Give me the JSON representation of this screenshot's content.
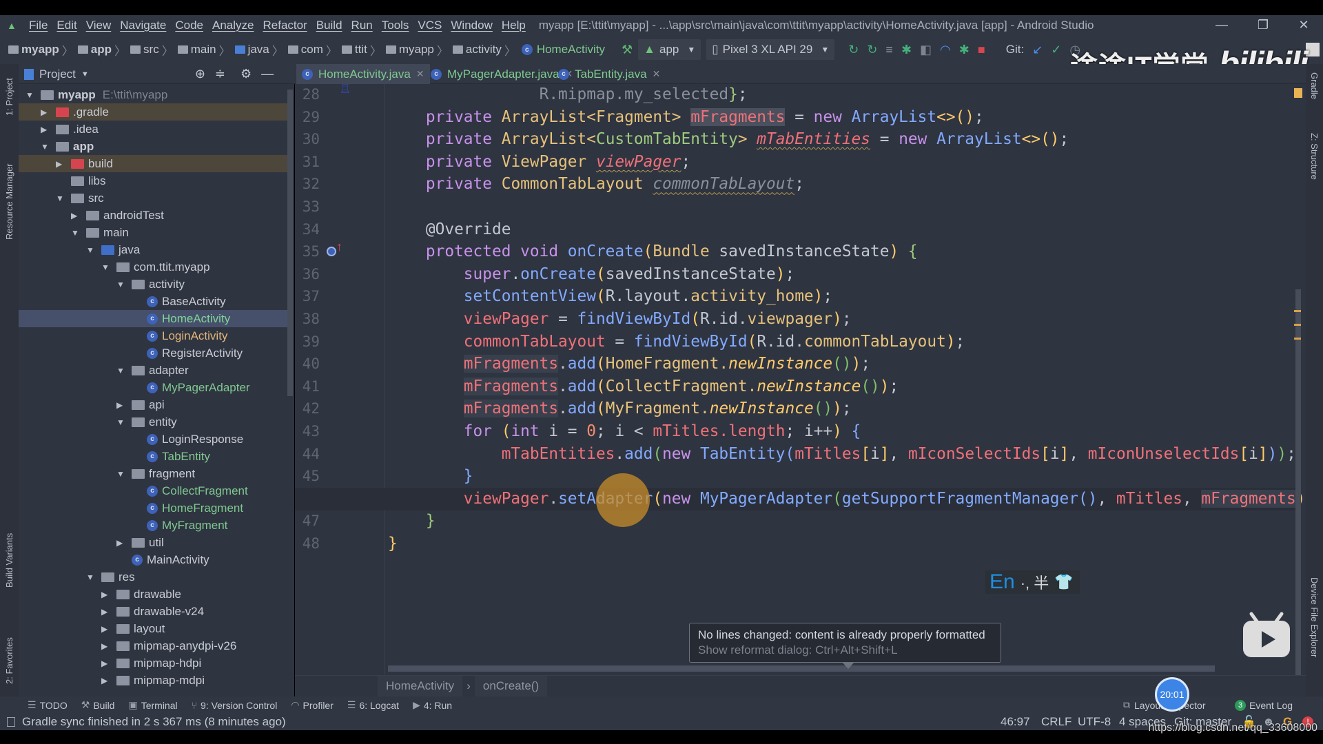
{
  "window": {
    "menu": [
      "File",
      "Edit",
      "View",
      "Navigate",
      "Code",
      "Analyze",
      "Refactor",
      "Build",
      "Run",
      "Tools",
      "VCS",
      "Window",
      "Help"
    ],
    "title": "myapp [E:\\ttit\\myapp] - ...\\app\\src\\main\\java\\com\\ttit\\myapp\\activity\\HomeActivity.java [app] - Android Studio",
    "controls": {
      "minimize": "—",
      "restore": "❐",
      "close": "✕"
    }
  },
  "navbar": {
    "breadcrumbs": [
      "myapp",
      "app",
      "src",
      "main",
      "java",
      "com",
      "ttit",
      "myapp",
      "activity",
      "HomeActivity"
    ],
    "run_config": "app",
    "device": "Pixel 3 XL API 29",
    "git_label": "Git:",
    "icons": [
      "hammer-icon",
      "apply-changes-icon",
      "apply-code-changes-icon",
      "sync-icon",
      "debug-icon",
      "attach-icon",
      "profiler-icon",
      "debug-attach-icon",
      "stop-icon",
      "git-update-icon",
      "git-commit-icon",
      "history-icon",
      "revert-icon",
      "folder-icon",
      "translate-icon",
      "device-manager-icon",
      "user-icon"
    ]
  },
  "project_panel": {
    "title": "Project",
    "tree": [
      {
        "label": "myapp",
        "hint": "E:\\ttit\\myapp",
        "depth": 0,
        "arrow": "down",
        "icon": "module",
        "bold": true
      },
      {
        "label": ".gradle",
        "depth": 1,
        "arrow": "right",
        "icon": "folder-excluded",
        "excluded": true
      },
      {
        "label": ".idea",
        "depth": 1,
        "arrow": "right",
        "icon": "folder"
      },
      {
        "label": "app",
        "depth": 1,
        "arrow": "down",
        "icon": "android-module",
        "bold": true
      },
      {
        "label": "build",
        "depth": 2,
        "arrow": "right",
        "icon": "folder-excluded",
        "excluded": true
      },
      {
        "label": "libs",
        "depth": 2,
        "icon": "folder"
      },
      {
        "label": "src",
        "depth": 2,
        "arrow": "down",
        "icon": "folder"
      },
      {
        "label": "androidTest",
        "depth": 3,
        "arrow": "right",
        "icon": "folder"
      },
      {
        "label": "main",
        "depth": 3,
        "arrow": "down",
        "icon": "folder"
      },
      {
        "label": "java",
        "depth": 4,
        "arrow": "down",
        "icon": "folder-source"
      },
      {
        "label": "com.ttit.myapp",
        "depth": 5,
        "arrow": "down",
        "icon": "package"
      },
      {
        "label": "activity",
        "depth": 6,
        "arrow": "down",
        "icon": "package"
      },
      {
        "label": "BaseActivity",
        "depth": 7,
        "icon": "class"
      },
      {
        "label": "HomeActivity",
        "depth": 7,
        "icon": "class",
        "color": "#7fd69a",
        "selected": true
      },
      {
        "label": "LoginActivity",
        "depth": 7,
        "icon": "class",
        "color": "#e3b77a"
      },
      {
        "label": "RegisterActivity",
        "depth": 7,
        "icon": "class"
      },
      {
        "label": "adapter",
        "depth": 6,
        "arrow": "down",
        "icon": "package"
      },
      {
        "label": "MyPagerAdapter",
        "depth": 7,
        "icon": "class",
        "color": "#7fc98f"
      },
      {
        "label": "api",
        "depth": 6,
        "arrow": "right",
        "icon": "package"
      },
      {
        "label": "entity",
        "depth": 6,
        "arrow": "down",
        "icon": "package"
      },
      {
        "label": "LoginResponse",
        "depth": 7,
        "icon": "class"
      },
      {
        "label": "TabEntity",
        "depth": 7,
        "icon": "class",
        "color": "#7fc98f"
      },
      {
        "label": "fragment",
        "depth": 6,
        "arrow": "down",
        "icon": "package"
      },
      {
        "label": "CollectFragment",
        "depth": 7,
        "icon": "class",
        "color": "#7fc98f"
      },
      {
        "label": "HomeFragment",
        "depth": 7,
        "icon": "class",
        "color": "#7fc98f"
      },
      {
        "label": "MyFragment",
        "depth": 7,
        "icon": "class",
        "color": "#7fc98f"
      },
      {
        "label": "util",
        "depth": 6,
        "arrow": "right",
        "icon": "package"
      },
      {
        "label": "MainActivity",
        "depth": 6,
        "icon": "class"
      },
      {
        "label": "res",
        "depth": 4,
        "arrow": "down",
        "icon": "folder-res"
      },
      {
        "label": "drawable",
        "depth": 5,
        "arrow": "right",
        "icon": "folder"
      },
      {
        "label": "drawable-v24",
        "depth": 5,
        "arrow": "right",
        "icon": "folder"
      },
      {
        "label": "layout",
        "depth": 5,
        "arrow": "right",
        "icon": "folder"
      },
      {
        "label": "mipmap-anydpi-v26",
        "depth": 5,
        "arrow": "right",
        "icon": "folder"
      },
      {
        "label": "mipmap-hdpi",
        "depth": 5,
        "arrow": "right",
        "icon": "folder"
      },
      {
        "label": "mipmap-mdpi",
        "depth": 5,
        "arrow": "right",
        "icon": "folder"
      }
    ]
  },
  "editor_tabs": [
    {
      "label": "HomeActivity.java",
      "active": true
    },
    {
      "label": "MyPagerAdapter.java"
    },
    {
      "label": "TabEntity.java"
    }
  ],
  "editor": {
    "first_line": 28,
    "current_line": 46,
    "lines": [
      [
        [
          "        R.mipmap.my_selected",
          "gy"
        ],
        [
          "}",
          "gr"
        ],
        [
          ";",
          "pl"
        ]
      ],
      [
        [
          "private ",
          "kw"
        ],
        [
          "ArrayList<Fragment> ",
          "ty"
        ],
        [
          "mFragments",
          "fld hl"
        ],
        [
          " = ",
          "pl"
        ],
        [
          "new ",
          "kw"
        ],
        [
          "ArrayList",
          "fn"
        ],
        [
          "<>()",
          "br"
        ],
        [
          ";",
          "pl"
        ]
      ],
      [
        [
          "private ",
          "kw"
        ],
        [
          "ArrayList<",
          "ty"
        ],
        [
          "CustomTabEntity",
          "gr"
        ],
        [
          "> ",
          "ty"
        ],
        [
          "mTabEntities",
          "fld it wv"
        ],
        [
          " = ",
          "pl"
        ],
        [
          "new ",
          "kw"
        ],
        [
          "ArrayList",
          "fn"
        ],
        [
          "<>()",
          "br"
        ],
        [
          ";",
          "pl"
        ]
      ],
      [
        [
          "private ",
          "kw"
        ],
        [
          "ViewPager ",
          "ty"
        ],
        [
          "viewPager",
          "fld it wv"
        ],
        [
          ";",
          "pl"
        ]
      ],
      [
        [
          "private ",
          "kw"
        ],
        [
          "CommonTabLayout ",
          "ty"
        ],
        [
          "commonTabLayout",
          "gy it wv"
        ],
        [
          ";",
          "pl"
        ]
      ],
      [],
      [
        [
          "@Override",
          "pl"
        ]
      ],
      [
        [
          "protected void ",
          "kw"
        ],
        [
          "onCreate",
          "fn"
        ],
        [
          "(",
          "br"
        ],
        [
          "Bundle ",
          "ty"
        ],
        [
          "savedInstanceState",
          "pl"
        ],
        [
          ")",
          "br"
        ],
        [
          " {",
          "gr"
        ]
      ],
      [
        [
          "    super",
          "kw"
        ],
        [
          ".",
          "pl"
        ],
        [
          "onCreate",
          "fn"
        ],
        [
          "(",
          "br"
        ],
        [
          "savedInstanceState",
          "pl"
        ],
        [
          ")",
          "br"
        ],
        [
          ";",
          "pl"
        ]
      ],
      [
        [
          "    setContentView",
          "fn"
        ],
        [
          "(",
          "br"
        ],
        [
          "R.layout.",
          "pl"
        ],
        [
          "activity_home",
          "ty"
        ],
        [
          ")",
          "br"
        ],
        [
          ";",
          "pl"
        ]
      ],
      [
        [
          "    viewPager",
          "fld"
        ],
        [
          " = ",
          "pl"
        ],
        [
          "findViewById",
          "fn"
        ],
        [
          "(",
          "br"
        ],
        [
          "R.id.",
          "pl"
        ],
        [
          "viewpager",
          "ty"
        ],
        [
          ")",
          "br"
        ],
        [
          ";",
          "pl"
        ]
      ],
      [
        [
          "    commonTabLayout",
          "fld"
        ],
        [
          " = ",
          "pl"
        ],
        [
          "findViewById",
          "fn"
        ],
        [
          "(",
          "br"
        ],
        [
          "R.id.",
          "pl"
        ],
        [
          "commonTabLayout",
          "ty"
        ],
        [
          ")",
          "br"
        ],
        [
          ";",
          "pl"
        ]
      ],
      [
        [
          "    ",
          "pl"
        ],
        [
          "mFragments",
          "fld hl2"
        ],
        [
          ".",
          "pl"
        ],
        [
          "add",
          "fn"
        ],
        [
          "(",
          "br"
        ],
        [
          "HomeFragment.",
          "ty"
        ],
        [
          "newInstance",
          "br it"
        ],
        [
          "()",
          "gp"
        ],
        [
          ")",
          "br"
        ],
        [
          ";",
          "pl"
        ]
      ],
      [
        [
          "    ",
          "pl"
        ],
        [
          "mFragments",
          "fld hl2"
        ],
        [
          ".",
          "pl"
        ],
        [
          "add",
          "fn"
        ],
        [
          "(",
          "br"
        ],
        [
          "CollectFragment.",
          "ty"
        ],
        [
          "newInstance",
          "br it"
        ],
        [
          "()",
          "gp"
        ],
        [
          ")",
          "br"
        ],
        [
          ";",
          "pl"
        ]
      ],
      [
        [
          "    ",
          "pl"
        ],
        [
          "mFragments",
          "fld hl2"
        ],
        [
          ".",
          "pl"
        ],
        [
          "add",
          "fn"
        ],
        [
          "(",
          "br"
        ],
        [
          "MyFragment.",
          "ty"
        ],
        [
          "newInstance",
          "br it"
        ],
        [
          "()",
          "gp"
        ],
        [
          ")",
          "br"
        ],
        [
          ";",
          "pl"
        ]
      ],
      [
        [
          "    for ",
          "kw"
        ],
        [
          "(",
          "br"
        ],
        [
          "int ",
          "kw"
        ],
        [
          "i = ",
          "pl"
        ],
        [
          "0",
          "nm"
        ],
        [
          "; i < ",
          "pl"
        ],
        [
          "mTitles.length",
          "fld"
        ],
        [
          "; i++",
          "pl"
        ],
        [
          ")",
          "br"
        ],
        [
          " {",
          "bl"
        ]
      ],
      [
        [
          "        mTabEntities",
          "fld"
        ],
        [
          ".",
          "pl"
        ],
        [
          "add",
          "fn"
        ],
        [
          "(",
          "gp"
        ],
        [
          "new ",
          "kw"
        ],
        [
          "TabEntity",
          "fn"
        ],
        [
          "(",
          "bl"
        ],
        [
          "mTitles",
          "fld"
        ],
        [
          "[",
          "br"
        ],
        [
          "i",
          "pl"
        ],
        [
          "]",
          "br"
        ],
        [
          ", ",
          "pl"
        ],
        [
          "mIconSelectIds",
          "fld"
        ],
        [
          "[",
          "br"
        ],
        [
          "i",
          "pl"
        ],
        [
          "]",
          "br"
        ],
        [
          ", ",
          "pl"
        ],
        [
          "mIconUnselectIds",
          "fld"
        ],
        [
          "[",
          "br"
        ],
        [
          "i",
          "pl"
        ],
        [
          "]",
          "br"
        ],
        [
          ")",
          "bl"
        ],
        [
          ")",
          "gp"
        ],
        [
          ";",
          "pl"
        ]
      ],
      [
        [
          "    }",
          "bl"
        ]
      ],
      [
        [
          "    viewPager",
          "fld"
        ],
        [
          ".",
          "pl"
        ],
        [
          "setAdapter",
          "fn"
        ],
        [
          "(",
          "br"
        ],
        [
          "new ",
          "kw"
        ],
        [
          "MyPagerAdapter",
          "fn"
        ],
        [
          "(",
          "gp"
        ],
        [
          "getSupportFragmentManager",
          "fn"
        ],
        [
          "()",
          "bl"
        ],
        [
          ", ",
          "pl"
        ],
        [
          "mTitles",
          "fld"
        ],
        [
          ", ",
          "pl"
        ],
        [
          "mFragments",
          "fld hl2"
        ],
        [
          "))",
          "br"
        ],
        [
          ";",
          "pl"
        ]
      ],
      [
        [
          "}",
          "gr"
        ]
      ],
      [
        [
          "}",
          "br"
        ]
      ]
    ],
    "indent_base": [
      2,
      1,
      1,
      1,
      1,
      1,
      1,
      1,
      1,
      1,
      1,
      1,
      1,
      1,
      1,
      1,
      1,
      1,
      1,
      1,
      0
    ]
  },
  "editor_breadcrumb": [
    "HomeActivity",
    "onCreate()"
  ],
  "notification": {
    "message": "No lines changed: content is already properly formatted",
    "hint": "Show reformat dialog: Ctrl+Alt+Shift+L"
  },
  "ime": {
    "lang": "En",
    "symbols": "·, 半",
    "skin_icon": "shirt-icon"
  },
  "overlay": {
    "watermark": "途途IT学堂",
    "brand": "bilibili",
    "clock": "20:01",
    "url": "https://blog.csdn.net/qq_33608000"
  },
  "left_strip": [
    "1: Project",
    "Resource Manager",
    "Build Variants",
    "2: Favorites"
  ],
  "right_strip": [
    "Gradle",
    "Z: Structure",
    "Device File Explorer"
  ],
  "tool_windows": [
    {
      "label": "TODO",
      "icon": "list-icon"
    },
    {
      "label": "Build",
      "icon": "hammer-icon"
    },
    {
      "label": "Terminal",
      "icon": "terminal-icon"
    },
    {
      "label": "9: Version Control",
      "icon": "vcs-icon"
    },
    {
      "label": "Profiler",
      "icon": "profiler-icon"
    },
    {
      "label": "6: Logcat",
      "icon": "logcat-icon"
    },
    {
      "label": "4: Run",
      "icon": "run-icon"
    }
  ],
  "tool_windows_right": [
    {
      "label": "Layout Inspector",
      "icon": "layout-inspector-icon"
    },
    {
      "label": "Event Log",
      "badge": "3"
    }
  ],
  "status": {
    "message": "Gradle sync finished in 2 s 367 ms (8 minutes ago)",
    "position": "46:97",
    "line_sep": "CRLF",
    "encoding": "UTF-8",
    "indent": "4 spaces",
    "vcs": "Git: master"
  }
}
